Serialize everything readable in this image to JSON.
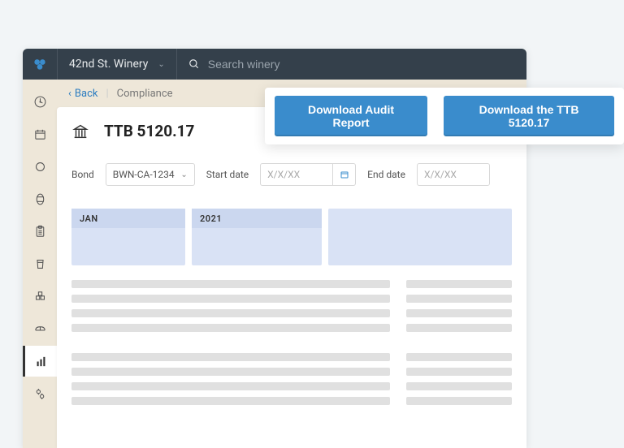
{
  "header": {
    "winery_name": "42nd St. Winery",
    "search_placeholder": "Search winery"
  },
  "breadcrumb": {
    "back_label": "Back",
    "section": "Compliance"
  },
  "page": {
    "title": "TTB 5120.17"
  },
  "filters": {
    "bond_label": "Bond",
    "bond_value": "BWN-CA-1234",
    "start_label": "Start date",
    "start_placeholder": "X/X/XX",
    "end_label": "End date",
    "end_placeholder": "X/X/XX"
  },
  "period": {
    "month": "JAN",
    "year": "2021"
  },
  "actions": {
    "download_audit": "Download Audit Report",
    "download_ttb": "Download the TTB 5120.17"
  },
  "colors": {
    "accent": "#3a8ccc",
    "topbar": "#34404b",
    "frame": "#eee7d9",
    "period": "#d9e2f5"
  }
}
